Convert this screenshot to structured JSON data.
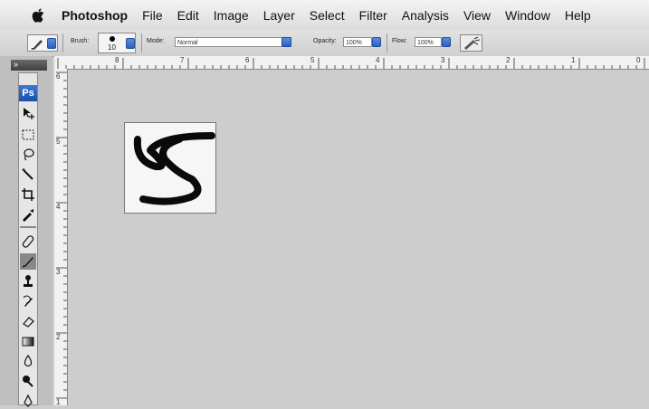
{
  "menubar": {
    "apple_icon": "apple-icon",
    "items": [
      "Photoshop",
      "File",
      "Edit",
      "Image",
      "Layer",
      "Select",
      "Filter",
      "Analysis",
      "View",
      "Window",
      "Help"
    ]
  },
  "options": {
    "brush_label": "Brush:",
    "brush_size": "10",
    "mode_label": "Mode:",
    "mode_value": "Normal",
    "opacity_label": "Opacity:",
    "opacity_value": "100%",
    "flow_label": "Flow:",
    "flow_value": "100%",
    "airbrush_icon": "airbrush-icon"
  },
  "ruler": {
    "h_labels": [
      "8",
      "7",
      "6",
      "5",
      "4",
      "3",
      "2",
      "1",
      "0"
    ],
    "v_labels": [
      "6",
      "5",
      "4",
      "3",
      "2",
      "1"
    ]
  },
  "toolbox": {
    "logo": "Ps",
    "collapse_icon": "collapse-icon",
    "tools": [
      "move-tool-icon",
      "marquee-tool-icon",
      "lasso-tool-icon",
      "magic-wand-tool-icon",
      "crop-tool-icon",
      "eyedropper-tool-icon",
      "healing-brush-tool-icon",
      "brush-tool-icon",
      "clone-stamp-tool-icon",
      "history-brush-tool-icon",
      "eraser-tool-icon",
      "gradient-tool-icon",
      "blur-tool-icon",
      "dodge-tool-icon",
      "pen-tool-icon"
    ]
  },
  "colors": {
    "canvas_bg": "#cdcdcd",
    "accent": "#2a5fc0"
  }
}
